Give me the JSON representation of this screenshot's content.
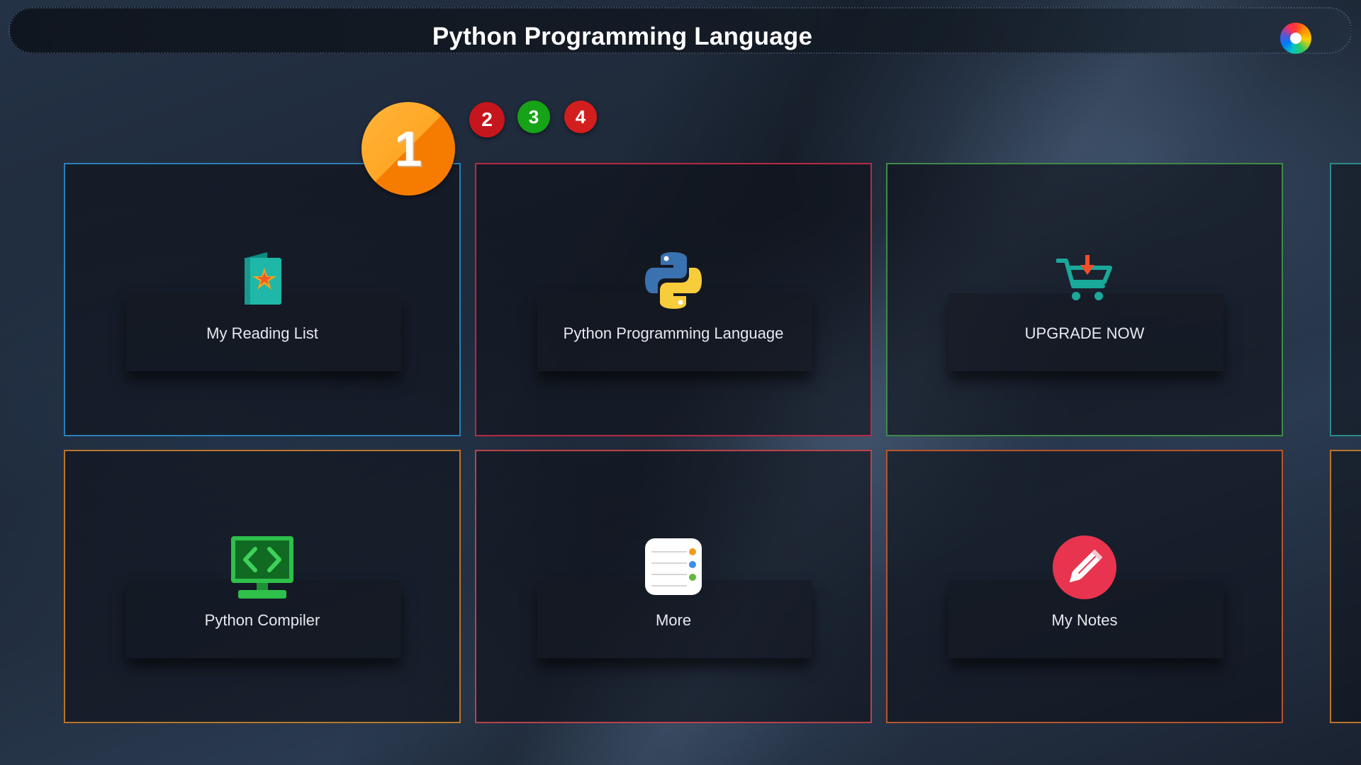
{
  "header": {
    "title": "Python Programming Language",
    "color_wheel_icon": "color-wheel-icon"
  },
  "pagination": {
    "pages": [
      {
        "label": "1",
        "color": "#ffa726"
      },
      {
        "label": "2",
        "color": "#c4161c"
      },
      {
        "label": "3",
        "color": "#17a317"
      },
      {
        "label": "4",
        "color": "#d31e1e"
      }
    ],
    "active": "1"
  },
  "tiles": [
    {
      "label": "My Reading List",
      "icon": "book-star-icon",
      "border": "#2a7fb8"
    },
    {
      "label": "Python Programming Language",
      "icon": "python-logo-icon",
      "border": "#b52b45"
    },
    {
      "label": "UPGRADE NOW",
      "icon": "shopping-cart-icon",
      "border": "#3f8a4a"
    },
    {
      "label": "Python Compiler",
      "icon": "code-monitor-icon",
      "border": "#b8742a"
    },
    {
      "label": "More",
      "icon": "list-icon",
      "border": "#b8424a"
    },
    {
      "label": "My Notes",
      "icon": "pencil-icon",
      "border": "#b8542a"
    }
  ]
}
